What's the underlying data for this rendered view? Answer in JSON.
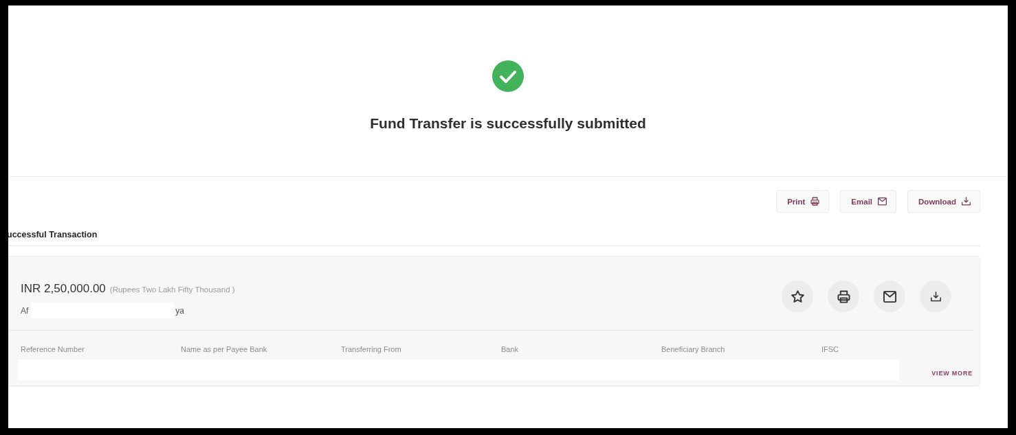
{
  "status": {
    "title": "Fund Transfer is successfully submitted"
  },
  "actions": [
    {
      "kind": "print",
      "label": "Print"
    },
    {
      "kind": "email",
      "label": "Email"
    },
    {
      "kind": "download",
      "label": "Download"
    }
  ],
  "section_title": "uccessful Transaction",
  "transaction": {
    "amount": "INR 2,50,000.00",
    "amount_words": "(Rupees Two Lakh Fifty Thousand )",
    "name_start": "Af",
    "name_end": "ya",
    "quick_actions": [
      {
        "kind": "star"
      },
      {
        "kind": "print"
      },
      {
        "kind": "email"
      },
      {
        "kind": "download"
      }
    ],
    "columns": [
      "Reference Number",
      "Name as per Payee Bank",
      "Transferring From",
      "Bank",
      "Beneficiary Branch",
      "IFSC"
    ],
    "view_more": "VIEW MORE"
  }
}
